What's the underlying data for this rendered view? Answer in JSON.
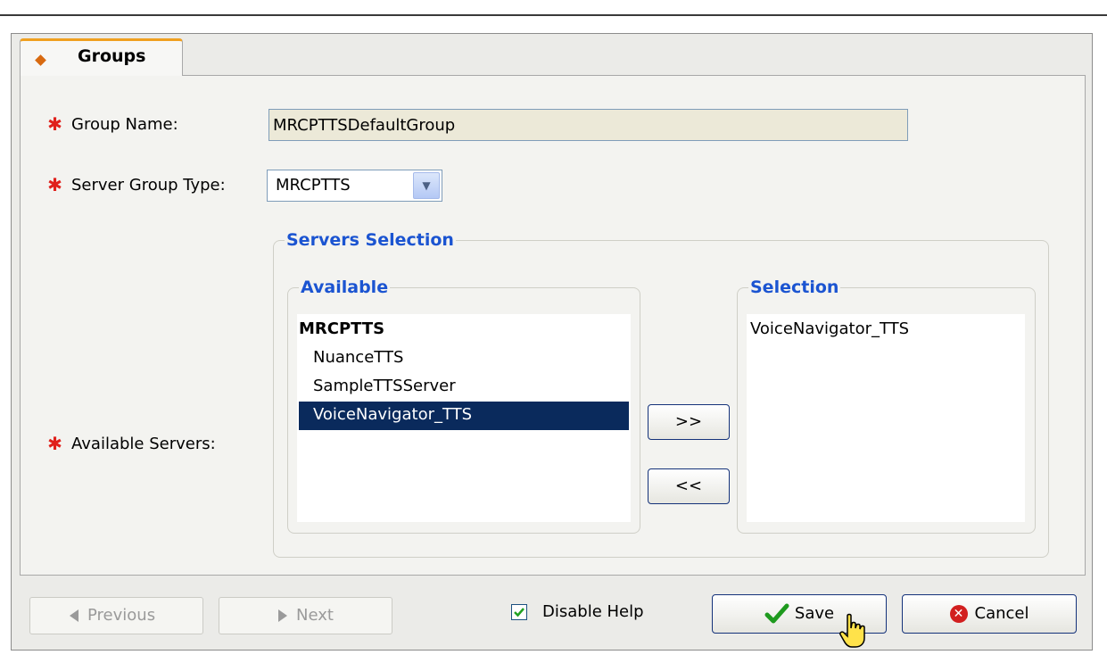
{
  "tab": {
    "label": "Groups"
  },
  "form": {
    "group_name": {
      "label": "Group Name:",
      "value": "MRCPTTSDefaultGroup"
    },
    "server_group_type": {
      "label": "Server Group Type:",
      "value": "MRCPTTS"
    },
    "available_servers": {
      "label": "Available Servers:"
    },
    "required_marker": "✱"
  },
  "servers_selection": {
    "title": "Servers Selection",
    "available": {
      "title": "Available",
      "group_header": "MRCPTTS",
      "items": [
        "NuanceTTS",
        "SampleTTSServer",
        "VoiceNavigator_TTS"
      ],
      "selected_item": "VoiceNavigator_TTS"
    },
    "add_label": ">>",
    "remove_label": "<<",
    "selection": {
      "title": "Selection",
      "items": [
        "VoiceNavigator_TTS"
      ]
    }
  },
  "footer": {
    "previous_label": "Previous",
    "next_label": "Next",
    "disable_help_label": "Disable Help",
    "disable_help_checked": true,
    "save_label": "Save",
    "cancel_label": "Cancel"
  },
  "colors": {
    "accent_legend": "#1b54d1",
    "selected_row": "#0a2a5c",
    "required": "#e0201b",
    "tab_highlight": "#f0a020"
  }
}
